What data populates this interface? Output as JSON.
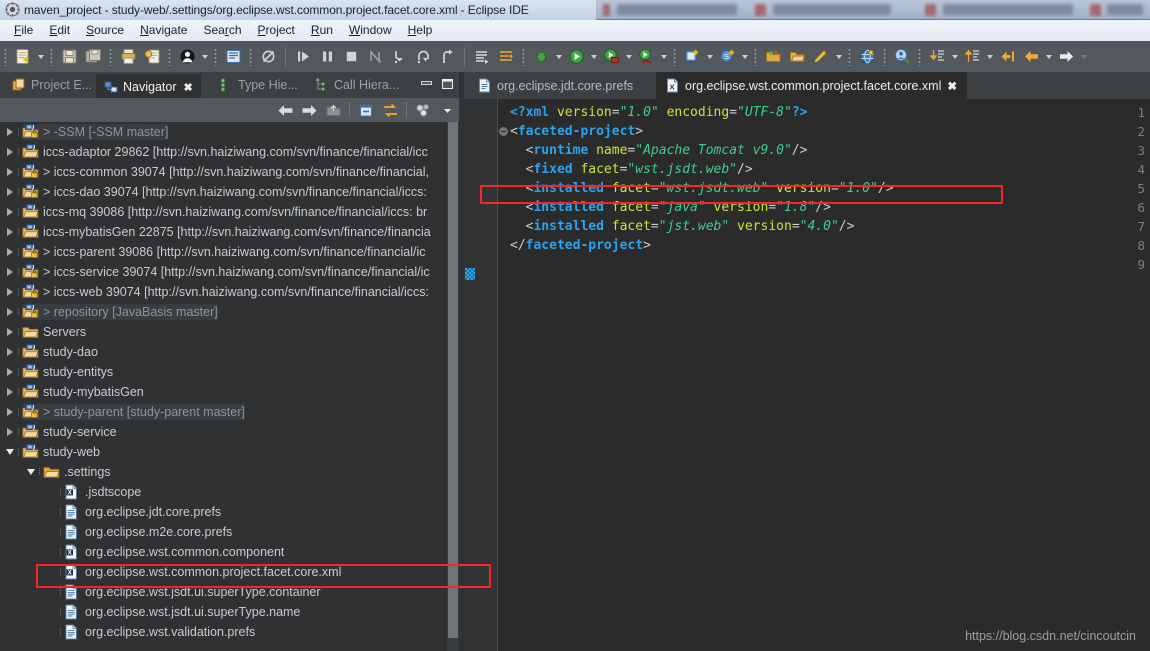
{
  "window": {
    "title": "maven_project - study-web/.settings/org.eclipse.wst.common.project.facet.core.xml - Eclipse IDE",
    "app_icon": "eclipse-icon"
  },
  "menu": {
    "items": [
      {
        "label": "File",
        "mnemonic": "F"
      },
      {
        "label": "Edit",
        "mnemonic": "E"
      },
      {
        "label": "Source",
        "mnemonic": "S"
      },
      {
        "label": "Navigate",
        "mnemonic": "N"
      },
      {
        "label": "Search",
        "mnemonic": "r"
      },
      {
        "label": "Project",
        "mnemonic": "P"
      },
      {
        "label": "Run",
        "mnemonic": "R"
      },
      {
        "label": "Window",
        "mnemonic": "W"
      },
      {
        "label": "Help",
        "mnemonic": "H"
      }
    ]
  },
  "toolbar": {
    "groups": [
      [
        "new-wizard-icon",
        "dropdown"
      ],
      [
        "save-icon",
        "save-all-icon"
      ],
      [
        "print-icon",
        "export-icon"
      ],
      [
        "user-icon",
        "dropdown"
      ],
      [
        "console-icon"
      ],
      [
        "skip-breakpoints-icon"
      ],
      [
        "resume-icon",
        "suspend-icon",
        "terminate-icon",
        "disconnect-icon",
        "step-into-icon",
        "step-over-icon",
        "step-return-icon"
      ],
      [
        "next-annotation-icon",
        "toggle-mark-icon"
      ],
      [
        "debug-icon",
        "dropdown"
      ],
      [
        "run-icon",
        "dropdown"
      ],
      [
        "run-external-icon",
        "dropdown"
      ],
      [
        "run-server-icon",
        "dropdown"
      ],
      [
        "new-java-project-icon",
        "dropdown"
      ],
      [
        "new-class-icon",
        "dropdown"
      ],
      [
        "open-task-icon",
        "open-folder-icon",
        "edit-icon",
        "dropdown"
      ],
      [
        "web-browser-icon"
      ],
      [
        "search-person-icon"
      ],
      [
        "prev-edit-icon",
        "dropdown"
      ],
      [
        "next-edit-icon",
        "dropdown"
      ],
      [
        "back-jump-icon",
        "back-icon",
        "dropdown"
      ],
      [
        "forward-icon",
        "dropdown-dim"
      ]
    ]
  },
  "left_view": {
    "tabs": [
      {
        "label": "Project E...",
        "icon": "project-explorer-icon",
        "active": false,
        "closable": false
      },
      {
        "label": "Navigator",
        "icon": "navigator-icon",
        "active": true,
        "closable": true
      },
      {
        "label": "Type Hie...",
        "icon": "type-hierarchy-icon",
        "active": false,
        "closable": false
      },
      {
        "label": "Call Hiera...",
        "icon": "call-hierarchy-icon",
        "active": false,
        "closable": false
      }
    ],
    "window_buttons": [
      "minimize-icon",
      "maximize-icon"
    ],
    "view_toolbar": [
      "back-icon",
      "forward-icon",
      "up-icon",
      "collapse-all-icon",
      "link-with-editor-icon",
      "filter-icon",
      "view-menu-icon"
    ],
    "tree": [
      {
        "label": "> -SSM [-SSM master]",
        "indent": 0,
        "state": "collapsed",
        "icon": "maven-project-svn-icon",
        "muted": true,
        "selected_soft": true
      },
      {
        "label": "iccs-adaptor 29862 [http://svn.haiziwang.com/svn/finance/financial/icc",
        "indent": 0,
        "state": "collapsed",
        "icon": "maven-project-icon",
        "muted": false
      },
      {
        "label": "> iccs-common 39074 [http://svn.haiziwang.com/svn/finance/financial,",
        "indent": 0,
        "state": "collapsed",
        "icon": "maven-project-svn-icon",
        "muted": false
      },
      {
        "label": "> iccs-dao 39074 [http://svn.haiziwang.com/svn/finance/financial/iccs:",
        "indent": 0,
        "state": "collapsed",
        "icon": "maven-project-svn-icon",
        "muted": false
      },
      {
        "label": "iccs-mq 39086 [http://svn.haiziwang.com/svn/finance/financial/iccs: br",
        "indent": 0,
        "state": "collapsed",
        "icon": "maven-project-icon",
        "muted": false
      },
      {
        "label": "iccs-mybatisGen 22875 [http://svn.haiziwang.com/svn/finance/financia",
        "indent": 0,
        "state": "collapsed",
        "icon": "maven-project-icon",
        "muted": false
      },
      {
        "label": "> iccs-parent 39086 [http://svn.haiziwang.com/svn/finance/financial/ic",
        "indent": 0,
        "state": "collapsed",
        "icon": "maven-project-svn-icon",
        "muted": false
      },
      {
        "label": "> iccs-service 39074 [http://svn.haiziwang.com/svn/finance/financial/ic",
        "indent": 0,
        "state": "collapsed",
        "icon": "maven-project-svn-icon",
        "muted": false
      },
      {
        "label": "> iccs-web 39074 [http://svn.haiziwang.com/svn/finance/financial/iccs:",
        "indent": 0,
        "state": "collapsed",
        "icon": "maven-project-svn-icon",
        "muted": false
      },
      {
        "label": "> repository [JavaBasis master]",
        "indent": 0,
        "state": "collapsed",
        "icon": "maven-project-svn-icon",
        "muted": true,
        "selected_soft": true
      },
      {
        "label": "Servers",
        "indent": 0,
        "state": "collapsed",
        "icon": "folder-icon",
        "muted": false
      },
      {
        "label": "study-dao",
        "indent": 0,
        "state": "collapsed",
        "icon": "maven-project-icon",
        "muted": false
      },
      {
        "label": "study-entitys",
        "indent": 0,
        "state": "collapsed",
        "icon": "maven-project-icon",
        "muted": false
      },
      {
        "label": "study-mybatisGen",
        "indent": 0,
        "state": "collapsed",
        "icon": "maven-project-icon",
        "muted": false
      },
      {
        "label": "> study-parent [study-parent master]",
        "indent": 0,
        "state": "collapsed",
        "icon": "maven-project-svn-icon",
        "muted": true,
        "selected_soft": true
      },
      {
        "label": "study-service",
        "indent": 0,
        "state": "collapsed",
        "icon": "maven-project-icon",
        "muted": false
      },
      {
        "label": "study-web",
        "indent": 0,
        "state": "expanded",
        "icon": "maven-project-icon",
        "muted": false
      },
      {
        "label": ".settings",
        "indent": 1,
        "state": "expanded",
        "icon": "folder-open-icon",
        "muted": false
      },
      {
        "label": ".jsdtscope",
        "indent": 2,
        "state": "leaf",
        "icon": "xml-file-icon",
        "muted": false
      },
      {
        "label": "org.eclipse.jdt.core.prefs",
        "indent": 2,
        "state": "leaf",
        "icon": "text-file-icon",
        "muted": false
      },
      {
        "label": "org.eclipse.m2e.core.prefs",
        "indent": 2,
        "state": "leaf",
        "icon": "text-file-icon",
        "muted": false
      },
      {
        "label": "org.eclipse.wst.common.component",
        "indent": 2,
        "state": "leaf",
        "icon": "xml-file-icon",
        "muted": false
      },
      {
        "label": "org.eclipse.wst.common.project.facet.core.xml",
        "indent": 2,
        "state": "leaf",
        "icon": "xml-file-icon",
        "muted": false,
        "highlighted": true
      },
      {
        "label": "org.eclipse.wst.jsdt.ui.superType.container",
        "indent": 2,
        "state": "leaf",
        "icon": "text-file-icon",
        "muted": false
      },
      {
        "label": "org.eclipse.wst.jsdt.ui.superType.name",
        "indent": 2,
        "state": "leaf",
        "icon": "text-file-icon",
        "muted": false
      },
      {
        "label": "org.eclipse.wst.validation.prefs",
        "indent": 2,
        "state": "leaf",
        "icon": "text-file-icon",
        "muted": false
      }
    ]
  },
  "editor": {
    "tabs": [
      {
        "label": "org.eclipse.jdt.core.prefs",
        "icon": "text-file-icon",
        "active": false,
        "closable": false
      },
      {
        "label": "org.eclipse.wst.common.project.facet.core.xml",
        "icon": "xml-file-icon",
        "active": true,
        "closable": true
      }
    ],
    "lines": [
      {
        "num": "1",
        "fold": false,
        "highlight": false,
        "tokens": [
          {
            "t": "<?xml ",
            "c": "k-pi"
          },
          {
            "t": "version",
            "c": "k-attr"
          },
          {
            "t": "=",
            "c": "k-eq"
          },
          {
            "t": "\"1.0\"",
            "c": "k-val"
          },
          {
            "t": " ",
            "c": "k-eq"
          },
          {
            "t": "encoding",
            "c": "k-attr"
          },
          {
            "t": "=",
            "c": "k-eq"
          },
          {
            "t": "\"UTF-8\"",
            "c": "k-val"
          },
          {
            "t": "?>",
            "c": "k-pi"
          }
        ]
      },
      {
        "num": "2",
        "fold": true,
        "highlight": false,
        "tokens": [
          {
            "t": "<",
            "c": "k-ang"
          },
          {
            "t": "faceted-project",
            "c": "k-tag"
          },
          {
            "t": ">",
            "c": "k-ang"
          }
        ]
      },
      {
        "num": "3",
        "fold": false,
        "highlight": false,
        "tokens": [
          {
            "t": "  <",
            "c": "k-ang"
          },
          {
            "t": "runtime",
            "c": "k-tag"
          },
          {
            "t": " ",
            "c": "k-eq"
          },
          {
            "t": "name",
            "c": "k-attr"
          },
          {
            "t": "=",
            "c": "k-eq"
          },
          {
            "t": "\"Apache Tomcat v9.0\"",
            "c": "k-val"
          },
          {
            "t": "/>",
            "c": "k-ang"
          }
        ]
      },
      {
        "num": "4",
        "fold": false,
        "highlight": false,
        "tokens": [
          {
            "t": "  <",
            "c": "k-ang"
          },
          {
            "t": "fixed",
            "c": "k-tag"
          },
          {
            "t": " ",
            "c": "k-eq"
          },
          {
            "t": "facet",
            "c": "k-attr"
          },
          {
            "t": "=",
            "c": "k-eq"
          },
          {
            "t": "\"wst.jsdt.web\"",
            "c": "k-val"
          },
          {
            "t": "/>",
            "c": "k-ang"
          }
        ]
      },
      {
        "num": "5",
        "fold": false,
        "highlight": true,
        "tokens": [
          {
            "t": "  <",
            "c": "k-ang"
          },
          {
            "t": "installed",
            "c": "k-tag"
          },
          {
            "t": " ",
            "c": "k-eq"
          },
          {
            "t": "facet",
            "c": "k-attr"
          },
          {
            "t": "=",
            "c": "k-eq"
          },
          {
            "t": "\"wst.jsdt.web\"",
            "c": "k-val"
          },
          {
            "t": " ",
            "c": "k-eq"
          },
          {
            "t": "version",
            "c": "k-attr"
          },
          {
            "t": "=",
            "c": "k-eq"
          },
          {
            "t": "\"1.0\"",
            "c": "k-val"
          },
          {
            "t": "/>",
            "c": "k-ang"
          }
        ]
      },
      {
        "num": "6",
        "fold": false,
        "highlight": false,
        "tokens": [
          {
            "t": "  <",
            "c": "k-ang"
          },
          {
            "t": "installed",
            "c": "k-tag"
          },
          {
            "t": " ",
            "c": "k-eq"
          },
          {
            "t": "facet",
            "c": "k-attr"
          },
          {
            "t": "=",
            "c": "k-eq"
          },
          {
            "t": "\"java\"",
            "c": "k-val"
          },
          {
            "t": " ",
            "c": "k-eq"
          },
          {
            "t": "version",
            "c": "k-attr"
          },
          {
            "t": "=",
            "c": "k-eq"
          },
          {
            "t": "\"1.8\"",
            "c": "k-val"
          },
          {
            "t": "/>",
            "c": "k-ang"
          }
        ]
      },
      {
        "num": "7",
        "fold": false,
        "highlight": false,
        "tokens": [
          {
            "t": "  <",
            "c": "k-ang"
          },
          {
            "t": "installed",
            "c": "k-tag"
          },
          {
            "t": " ",
            "c": "k-eq"
          },
          {
            "t": "facet",
            "c": "k-attr"
          },
          {
            "t": "=",
            "c": "k-eq"
          },
          {
            "t": "\"jst.web\"",
            "c": "k-val"
          },
          {
            "t": " ",
            "c": "k-eq"
          },
          {
            "t": "version",
            "c": "k-attr"
          },
          {
            "t": "=",
            "c": "k-eq"
          },
          {
            "t": "\"4.0\"",
            "c": "k-val"
          },
          {
            "t": "/>",
            "c": "k-ang"
          }
        ]
      },
      {
        "num": "8",
        "fold": false,
        "highlight": false,
        "tokens": [
          {
            "t": "</",
            "c": "k-ang"
          },
          {
            "t": "faceted-project",
            "c": "k-tag"
          },
          {
            "t": ">",
            "c": "k-ang"
          }
        ]
      },
      {
        "num": "9",
        "fold": false,
        "highlight": false,
        "tokens": []
      }
    ]
  },
  "watermark": {
    "text": "https://blog.csdn.net/cincoutcin"
  },
  "colors": {
    "highlight_red": "#f5262a",
    "editor_bg": "#2b2b2b",
    "tree_bg": "#2f3133",
    "toolbar_bg": "#53585c",
    "tag_blue": "#2aa3f0",
    "attr_yellow": "#cfe23a",
    "value_green": "#3ecf8e"
  }
}
